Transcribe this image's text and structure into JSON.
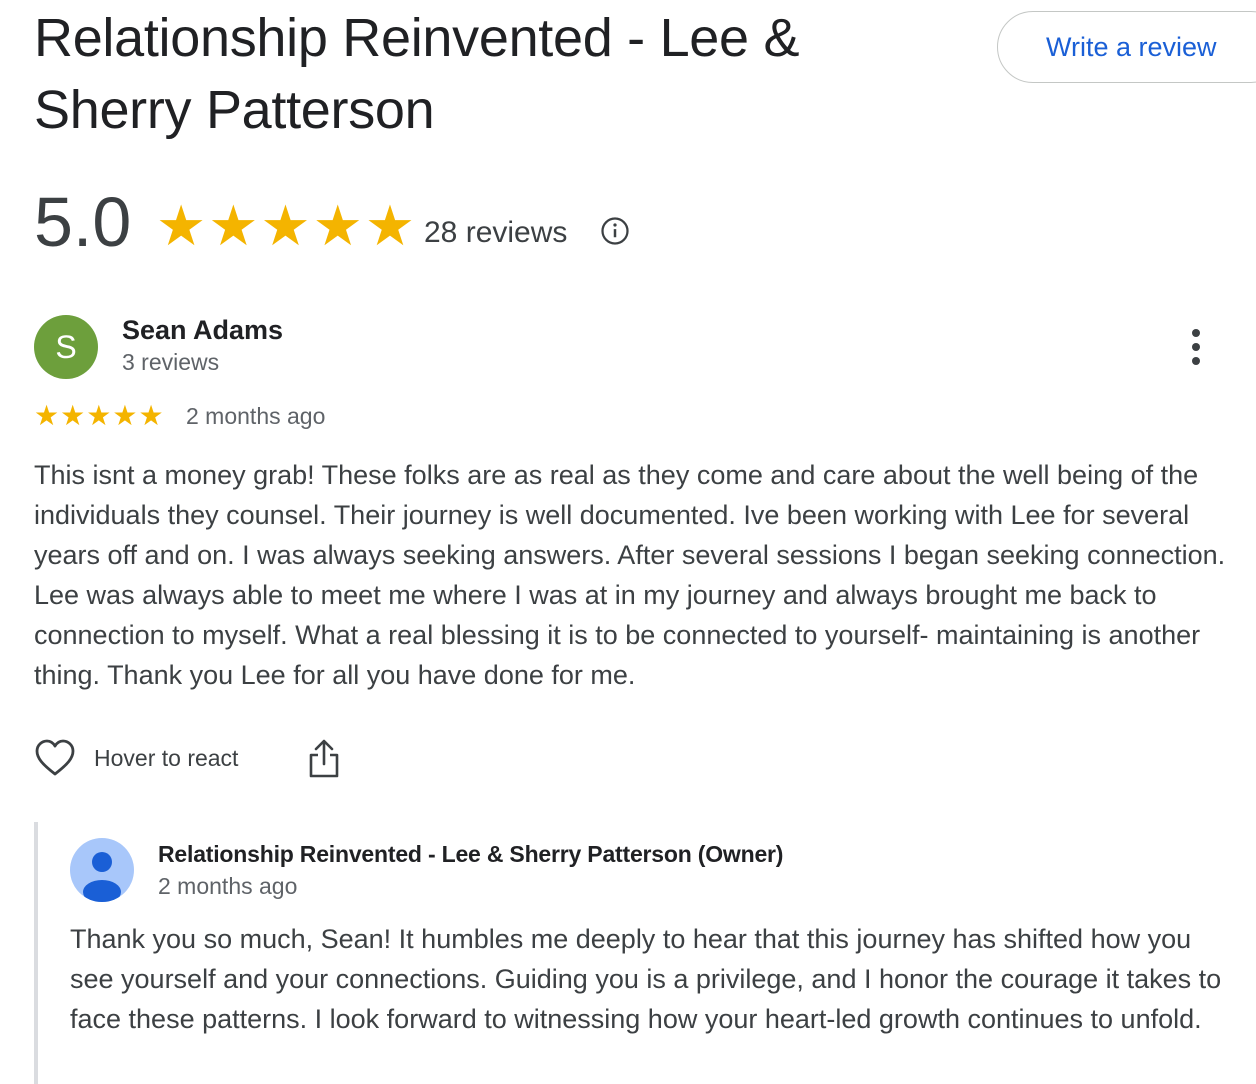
{
  "business": {
    "name": "Relationship Reinvented - Lee & Sherry Patterson",
    "write_review_label": "Write a review"
  },
  "rating": {
    "score": "5.0",
    "stars": 5,
    "reviews_count_label": "28 reviews",
    "star_color": "#f4b400"
  },
  "review": {
    "avatar_letter": "S",
    "avatar_color": "#6d9f3c",
    "reviewer_name": "Sean Adams",
    "reviewer_meta": "3 reviews",
    "stars": 5,
    "time": "2 months ago",
    "text": "This isnt a money grab! These folks are as real as they come and care about the well being of the individuals they counsel. Their journey is well documented. Ive been working with Lee for several years off and on. I was always seeking answers. After several sessions I began seeking connection. Lee was always able to meet me where I was at in my journey and always brought me back to connection to myself. What a real blessing it is to be connected to yourself- maintaining is another thing. Thank you Lee for all you have done for me.",
    "react_label": "Hover to react"
  },
  "owner_reply": {
    "name": "Relationship Reinvented - Lee & Sherry Patterson (Owner)",
    "time": "2 months ago",
    "text": "Thank you so much, Sean! It humbles me deeply to hear that this journey has shifted how you see yourself and your connections. Guiding you is a privilege, and I honor the courage it takes to face these patterns. I look forward to witnessing how your heart-led growth continues to unfold."
  },
  "icons": {
    "info": "info-icon",
    "more": "more-vertical-icon",
    "heart": "heart-icon",
    "share": "share-icon",
    "owner_avatar": "default-profile-icon"
  },
  "colors": {
    "link_blue": "#1a5fd6",
    "text_secondary": "#5f6368"
  }
}
